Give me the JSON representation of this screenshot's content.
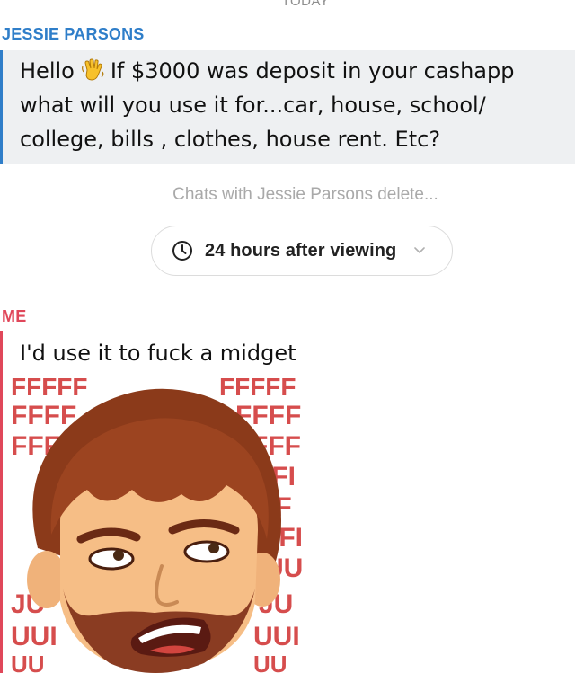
{
  "chat": {
    "day_label": "TODAY",
    "them": {
      "name": "JESSIE PARSONS",
      "lines": [
        {
          "pre": "Hello",
          "emoji": "waving-hand-icon",
          "post": "If $3000 was deposit in your cashapp"
        },
        {
          "text": "what will you use it for...car, house, school/"
        },
        {
          "text": "college, bills , clothes, house rent. Etc?"
        }
      ]
    },
    "delete_notice": "Chats with Jessie Parsons delete...",
    "timer": {
      "label": "24 hours after viewing",
      "icon": "clock-icon",
      "dropdown_icon": "chevron-down-icon"
    },
    "me": {
      "name": "ME",
      "text": "I'd use it to fuck a midget",
      "sticker": "bitmoji-frustrated-sticker"
    },
    "sticker_background_letters": [
      "FFFFF",
      "FFFF",
      "FFF",
      "FF",
      "FFI",
      "UU",
      "JU",
      "UUI"
    ],
    "colors": {
      "them_accent": "#2f7ec9",
      "me_accent": "#e0475a",
      "bubble_bg": "#eef0f2",
      "sticker_letters": "#d23a3a"
    }
  }
}
